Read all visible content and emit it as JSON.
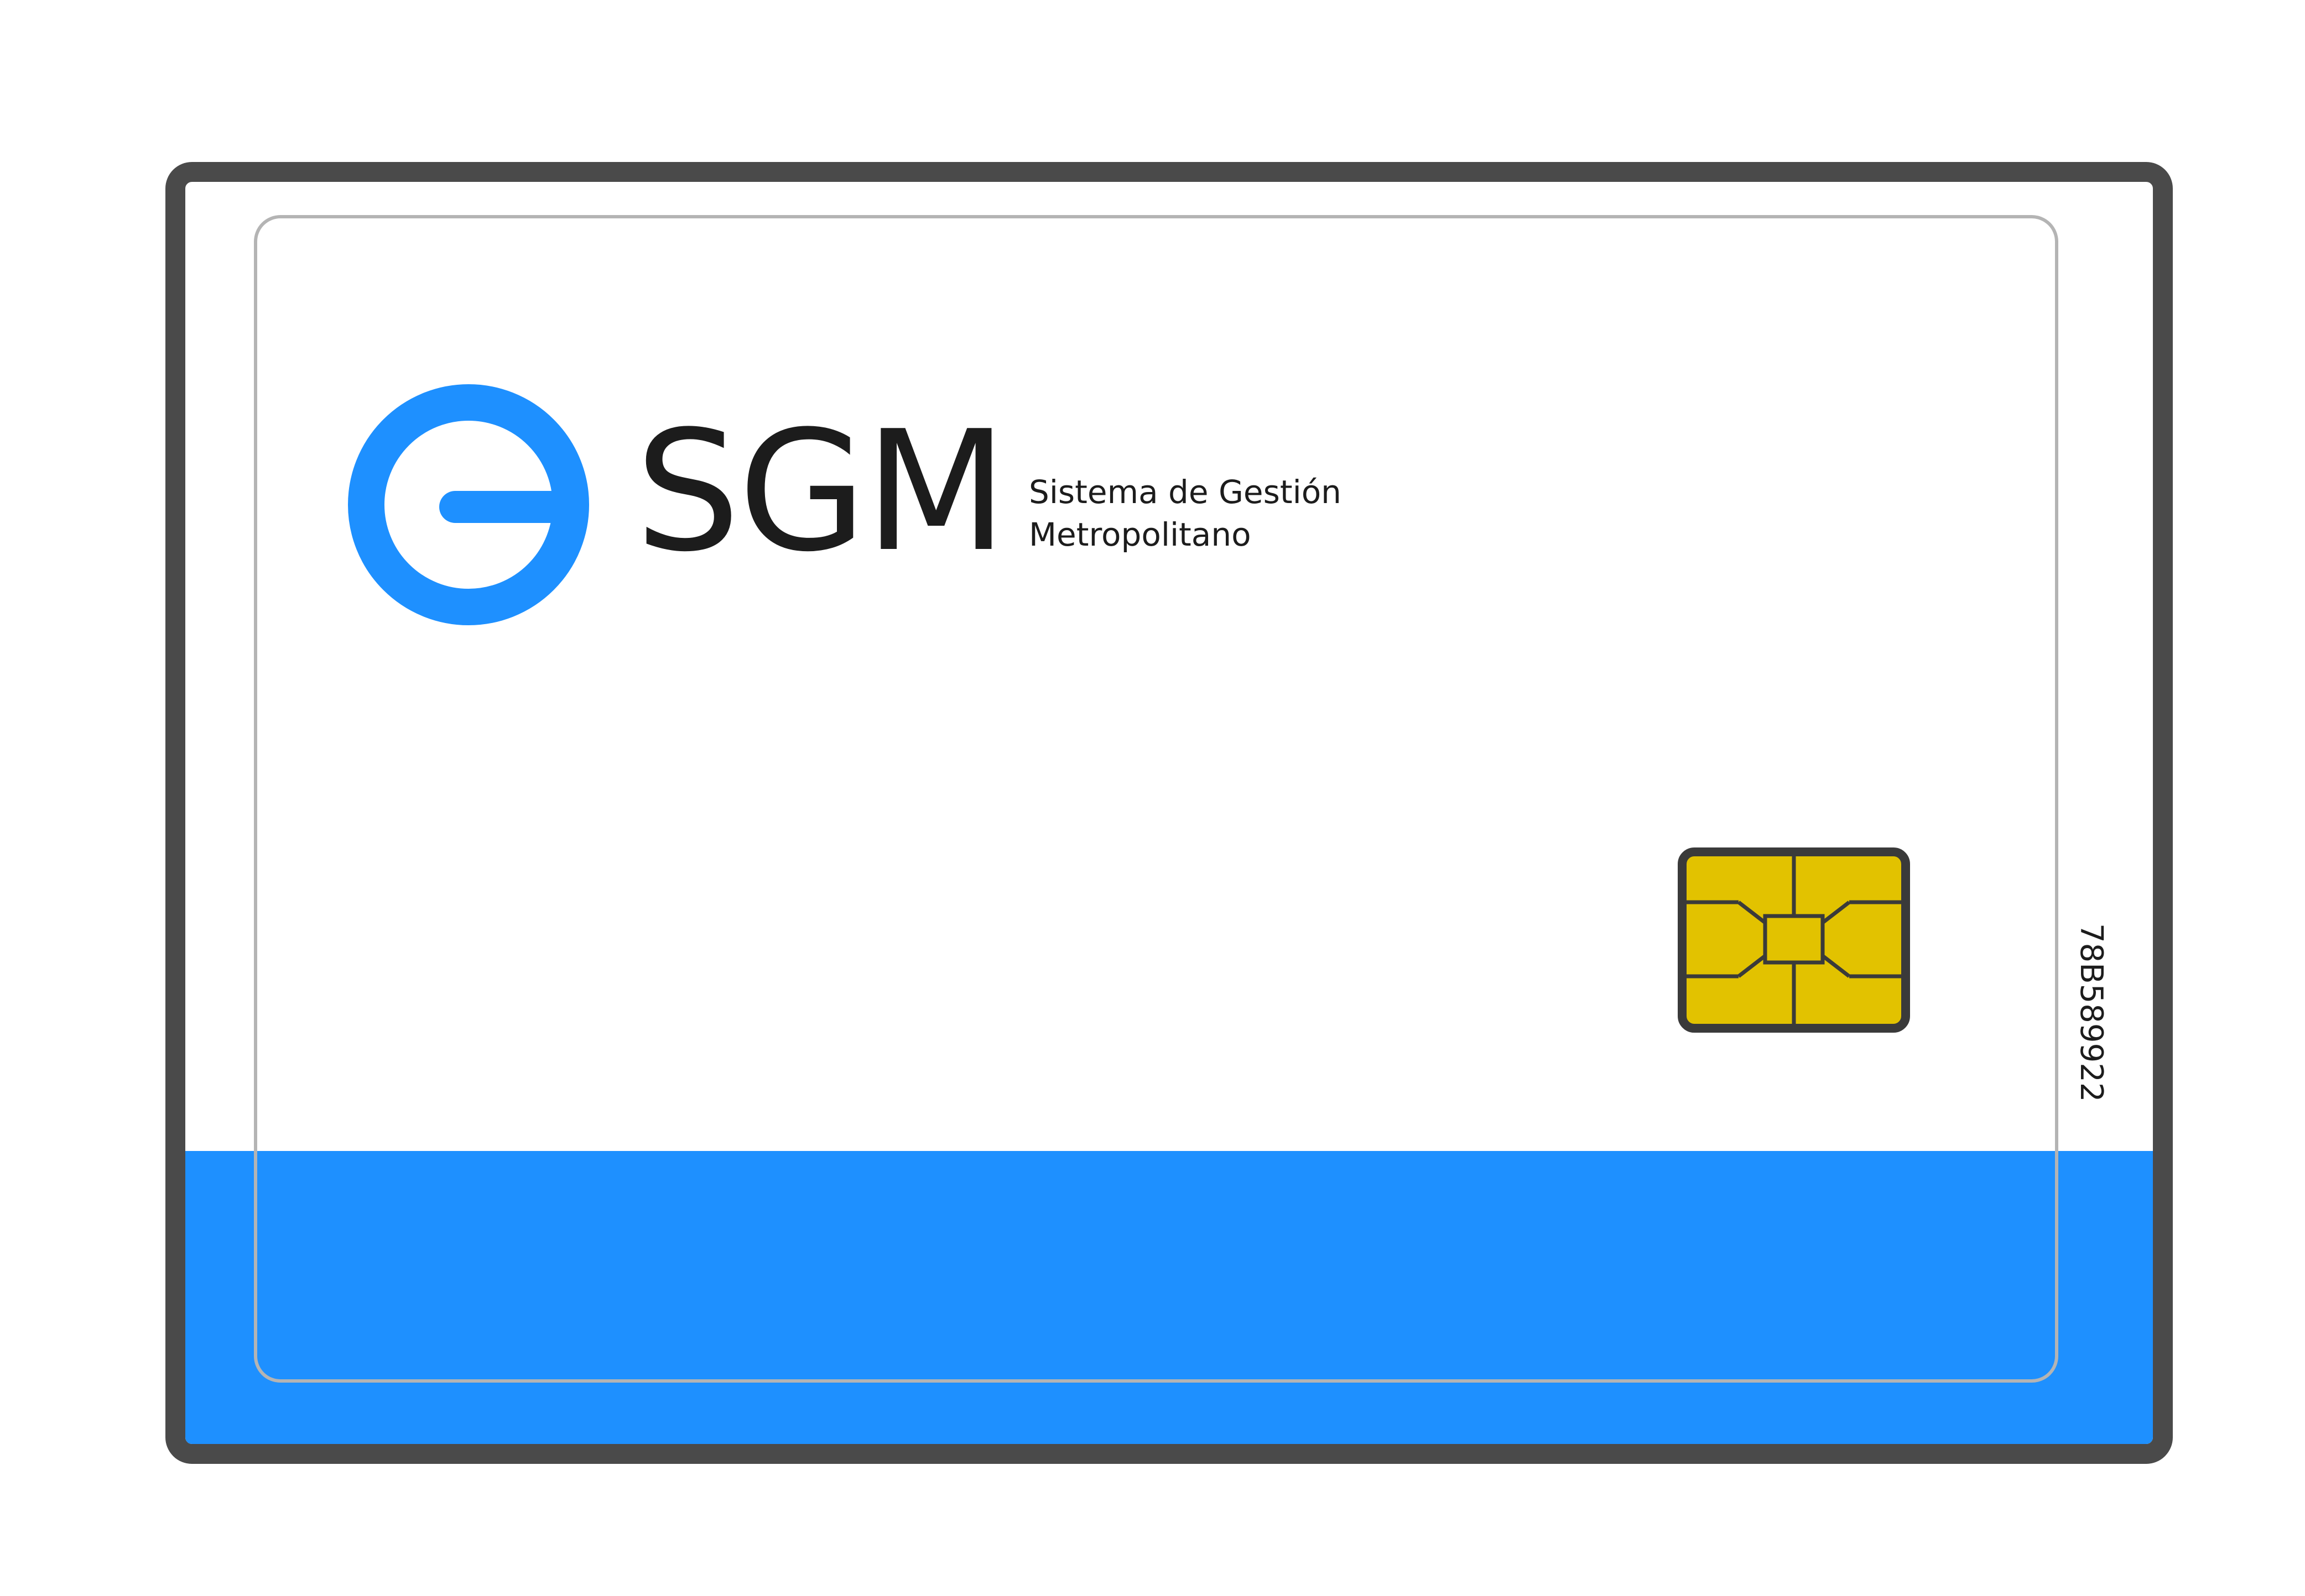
{
  "card": {
    "band_color": "#1e90ff",
    "border_color": "#4a4a4a",
    "chip_color": "#e2c200"
  },
  "logo": {
    "icon": "sgm-ring-logo-icon",
    "wordmark": "SGM",
    "tagline_line1": "Sistema de Gestión",
    "tagline_line2": "Metropolitano"
  },
  "serial_number": "78B589922"
}
